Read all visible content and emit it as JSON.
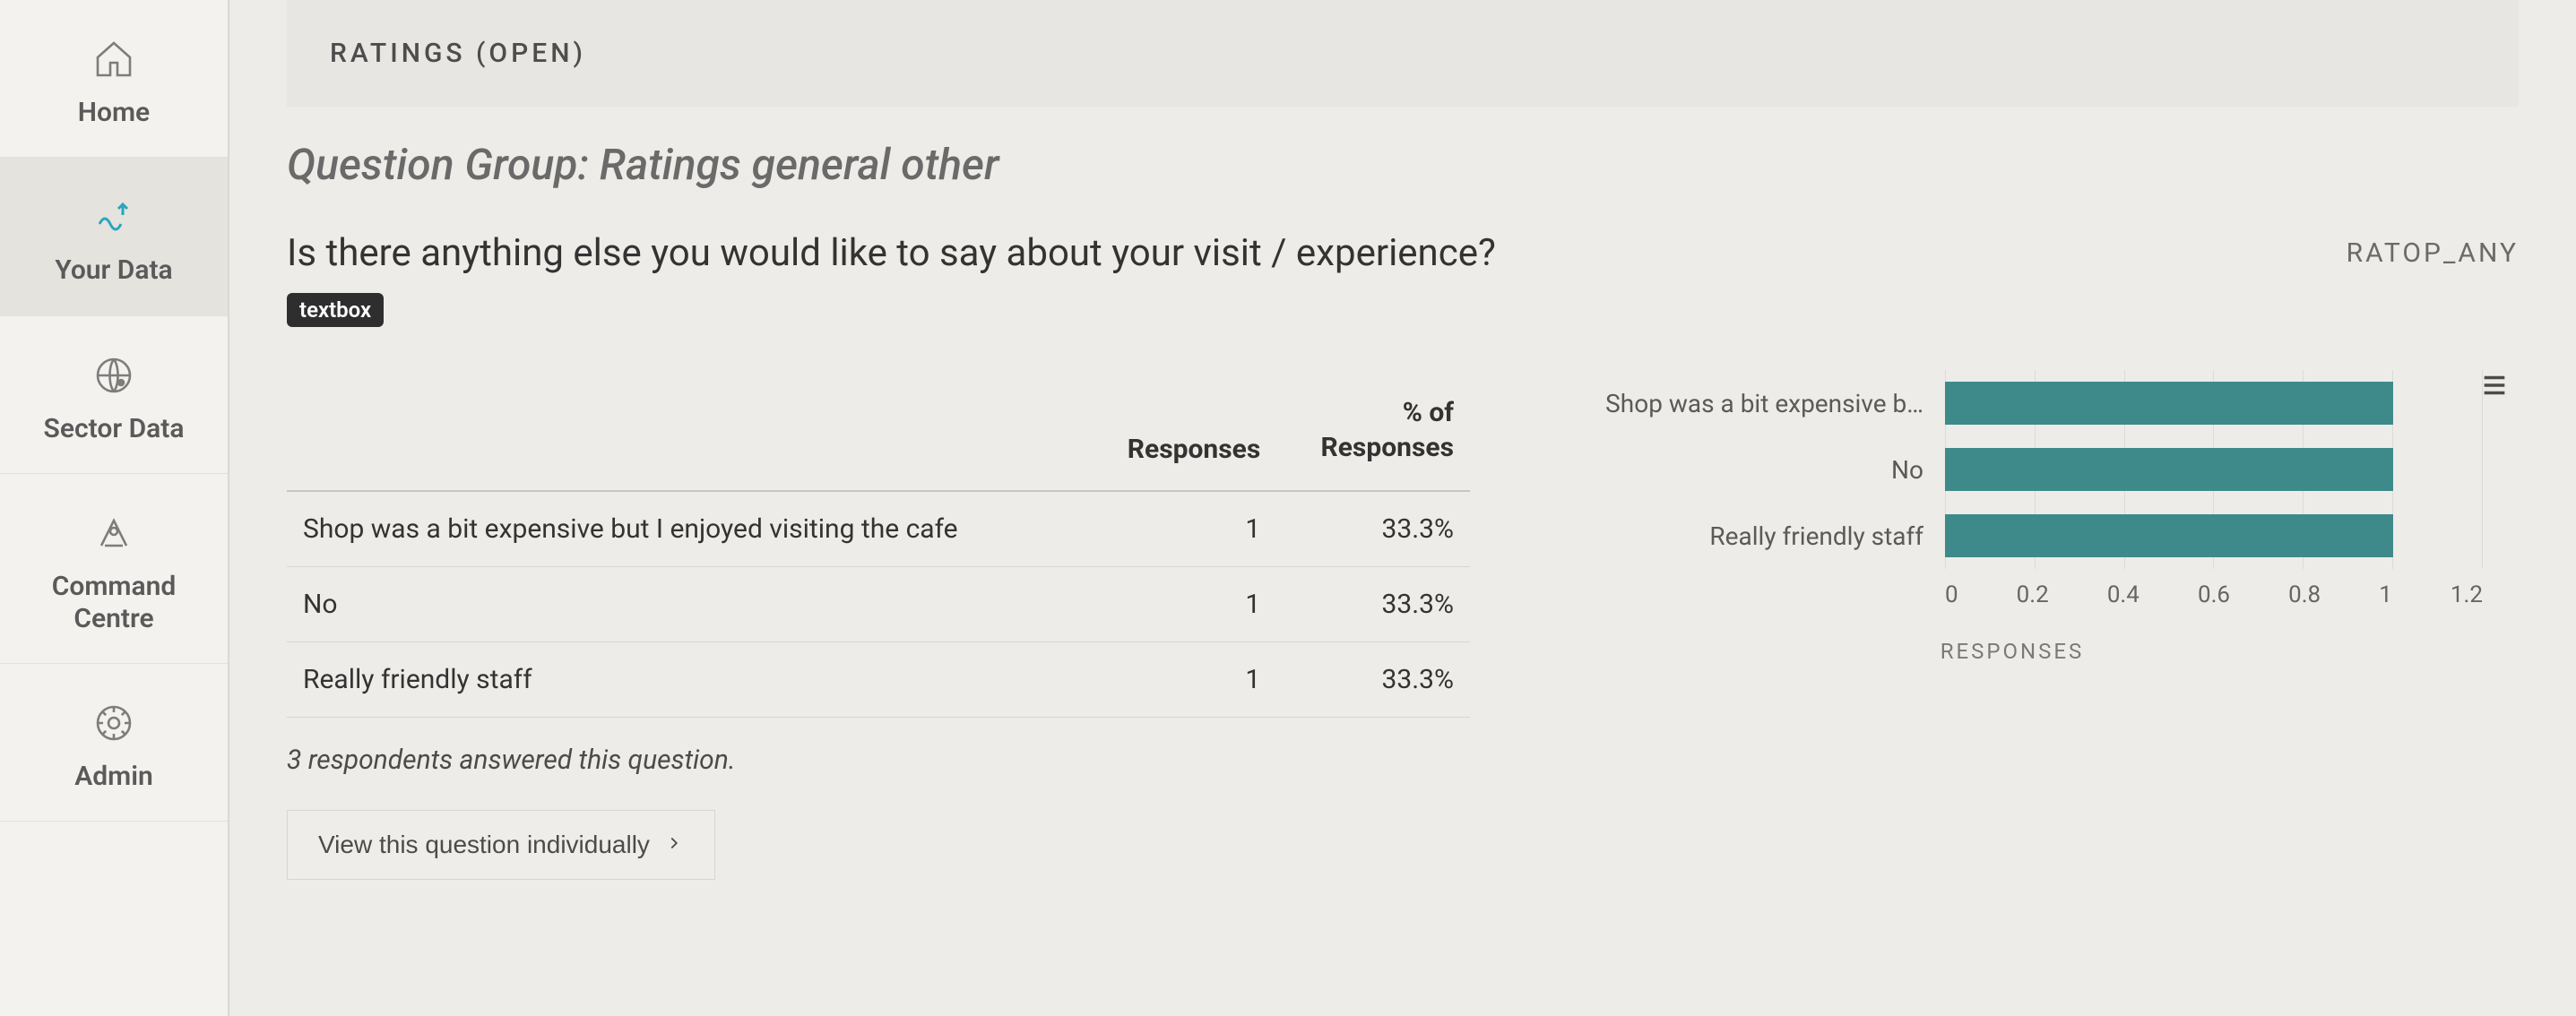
{
  "sidebar": {
    "items": [
      {
        "label": "Home",
        "icon": "home-icon",
        "active": false
      },
      {
        "label": "Your Data",
        "icon": "your-data-icon",
        "active": true
      },
      {
        "label": "Sector Data",
        "icon": "sector-data-icon",
        "active": false
      },
      {
        "label": "Command Centre",
        "icon": "command-centre-icon",
        "active": false
      },
      {
        "label": "Admin",
        "icon": "admin-icon",
        "active": false
      }
    ]
  },
  "header": {
    "title": "RATINGS (OPEN)"
  },
  "group": {
    "title": "Question Group: Ratings general other"
  },
  "question": {
    "text": "Is there anything else you would like to say about your visit / experience?",
    "code": "RATOP_ANY",
    "type_badge": "textbox"
  },
  "table": {
    "columns": {
      "c0": "",
      "c1": "Responses",
      "c2a": "% of",
      "c2b": "Responses"
    },
    "rows": [
      {
        "text": "Shop was a bit expensive but I enjoyed visiting the cafe",
        "responses": "1",
        "pct": "33.3%"
      },
      {
        "text": "No",
        "responses": "1",
        "pct": "33.3%"
      },
      {
        "text": "Really friendly staff",
        "responses": "1",
        "pct": "33.3%"
      }
    ]
  },
  "respondent_note": "3 respondents answered this question.",
  "view_button": "View this question individually",
  "chart_axis_title": "RESPONSES",
  "chart_data": {
    "type": "bar",
    "orientation": "horizontal",
    "categories": [
      "Shop was a bit expensive b…",
      "No",
      "Really friendly staff"
    ],
    "values": [
      1,
      1,
      1
    ],
    "xlabel": "RESPONSES",
    "ylabel": "",
    "xlim": [
      0,
      1.2
    ],
    "ticks": [
      "0",
      "0.2",
      "0.4",
      "0.6",
      "0.8",
      "1",
      "1.2"
    ],
    "color": "#3e8a8a"
  }
}
